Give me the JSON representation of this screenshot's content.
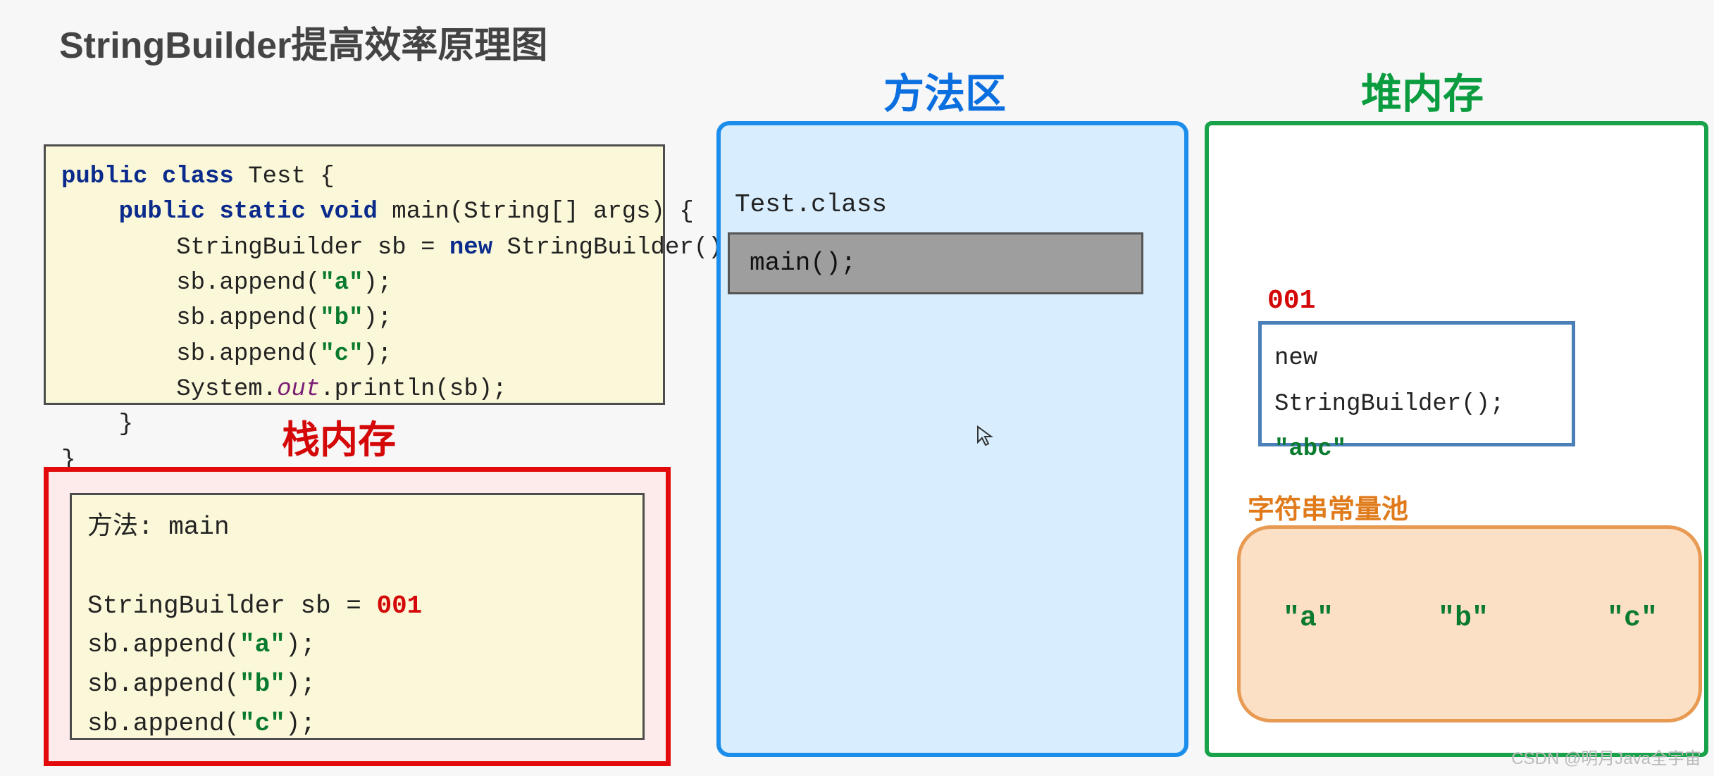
{
  "title": "StringBuilder提高效率原理图",
  "code": {
    "line1_kw": "public class",
    "line1_rest": " Test {",
    "line2_indent": "    ",
    "line2_kw": "public static void",
    "line2_rest": " main(String[] args) {",
    "line3_indent": "        ",
    "line3_a": "StringBuilder sb = ",
    "line3_kw": "new",
    "line3_b": " StringBuilder();",
    "line4": "        sb.append(",
    "str_a": "\"a\"",
    "line4_end": ");",
    "line5": "        sb.append(",
    "str_b": "\"b\"",
    "line5_end": ");",
    "line6": "        sb.append(",
    "str_c": "\"c\"",
    "line6_end": ");",
    "line7_a": "        System.",
    "line7_field": "out",
    "line7_b": ".println(sb);",
    "line8": "    }",
    "line9": "}"
  },
  "stack": {
    "label": "栈内存",
    "method_line": "方法: main",
    "blank": "",
    "decl_a": "StringBuilder sb = ",
    "addr": "001",
    "ap_a_pre": "sb.append(",
    "ap_a_str": "\"a\"",
    "ap_a_post": ");",
    "ap_b_pre": "sb.append(",
    "ap_b_str": "\"b\"",
    "ap_b_post": ");",
    "ap_c_pre": "sb.append(",
    "ap_c_str": "\"c\"",
    "ap_c_post": ");"
  },
  "method_area": {
    "label": "方法区",
    "class_file": "Test.class",
    "main_entry": "main();"
  },
  "heap": {
    "label": "堆内存",
    "addr": "001",
    "obj_line1": "new StringBuilder();",
    "obj_value": "\"abc\"",
    "pool_label": "字符串常量池",
    "pool_items": [
      "\"a\"",
      "\"b\"",
      "\"c\""
    ]
  },
  "cursor_glyph": "↖",
  "watermark": "CSDN @明月Java全宇宙"
}
